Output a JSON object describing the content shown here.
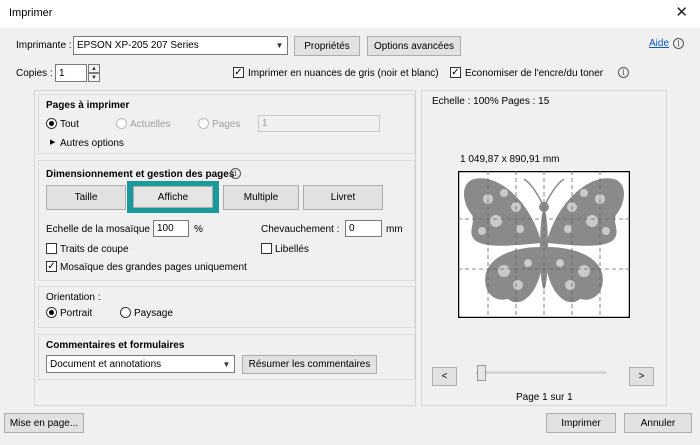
{
  "window": {
    "title": "Imprimer"
  },
  "printer": {
    "label": "Imprimante :",
    "selected": "EPSON XP-205 207 Series",
    "properties": "Propriétés",
    "advanced": "Options avancées",
    "help": "Aide"
  },
  "copies": {
    "label": "Copies :",
    "value": "1"
  },
  "options": {
    "grayscale": "Imprimer en nuances de gris (noir et blanc)",
    "save_ink": "Economiser de l'encre/du toner"
  },
  "pages": {
    "heading": "Pages à imprimer",
    "all": "Tout",
    "current": "Actuelles",
    "pages": "Pages",
    "pages_value": "1",
    "more": "Autres options"
  },
  "sizing": {
    "heading": "Dimensionnement et gestion des pages",
    "size": "Taille",
    "poster": "Affiche",
    "multiple": "Multiple",
    "booklet": "Livret",
    "tile_scale_label": "Echelle de la mosaïque :",
    "tile_scale_value": "100",
    "percent": "%",
    "overlap_label": "Chevauchement :",
    "overlap_value": "0",
    "mm": "mm",
    "cut_marks": "Traits de coupe",
    "labels": "Libellés",
    "tile_large": "Mosaïque des grandes pages uniquement"
  },
  "orientation": {
    "heading": "Orientation :",
    "portrait": "Portrait",
    "landscape": "Paysage"
  },
  "comments": {
    "heading": "Commentaires et formulaires",
    "selected": "Document et annotations",
    "summarize": "Résumer les commentaires"
  },
  "preview": {
    "scale": "Echelle : 100% Pages : 15",
    "dimensions": "1 049,87 x 890,91 mm",
    "prev": "<",
    "next": ">",
    "page_info": "Page 1 sur 1"
  },
  "footer": {
    "page_setup": "Mise en page...",
    "print": "Imprimer",
    "cancel": "Annuler"
  },
  "colors": {
    "highlight": "#1a9a9a",
    "butterfly": "#8a8a8a",
    "link": "#0b55c8"
  }
}
